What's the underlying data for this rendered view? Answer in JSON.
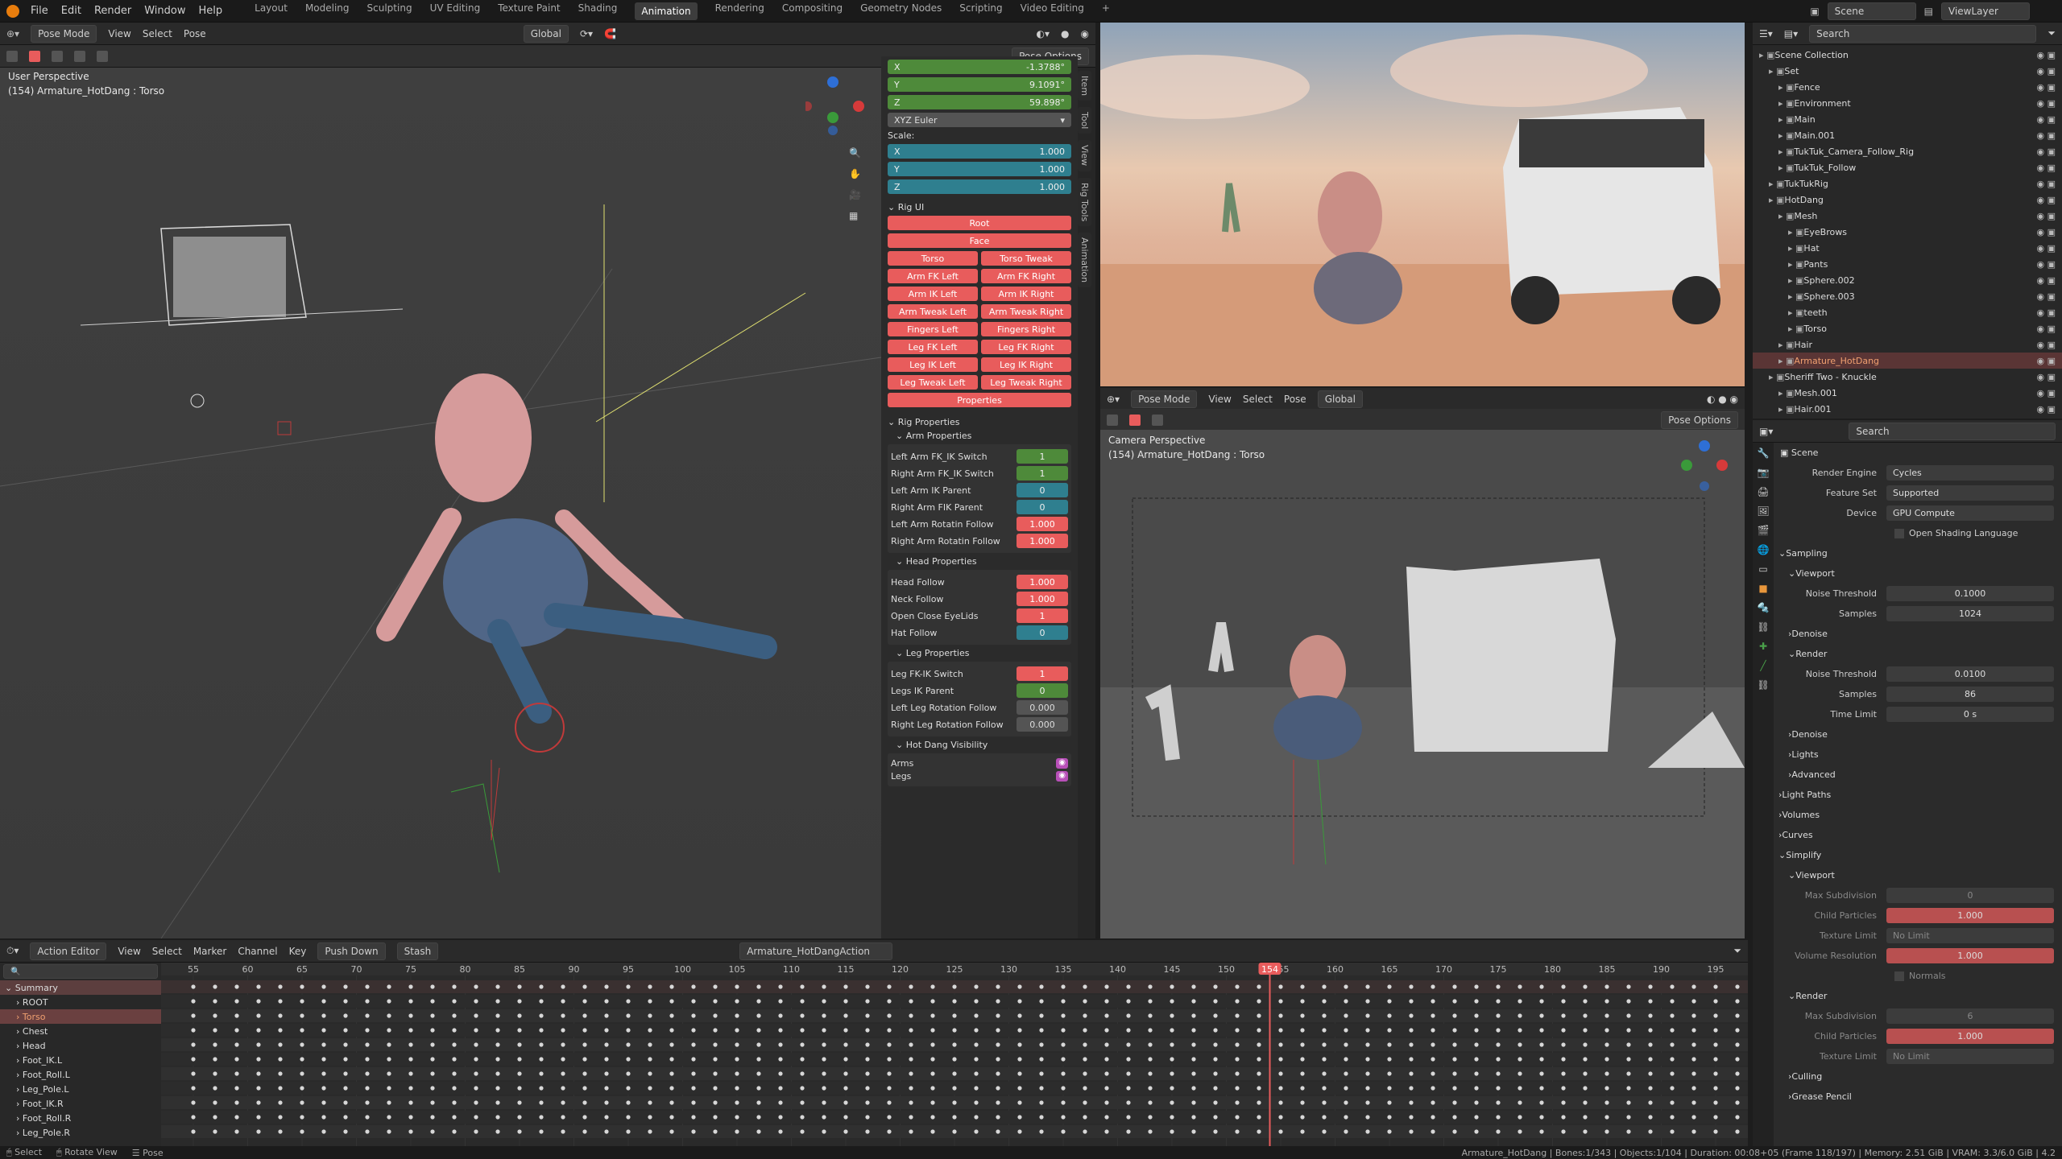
{
  "topbar": {
    "menus": [
      "File",
      "Edit",
      "Render",
      "Window",
      "Help"
    ],
    "workspaces": [
      "Layout",
      "Modeling",
      "Sculpting",
      "UV Editing",
      "Texture Paint",
      "Shading",
      "Animation",
      "Rendering",
      "Compositing",
      "Geometry Nodes",
      "Scripting",
      "Video Editing"
    ],
    "active_workspace": "Animation",
    "scene": "Scene",
    "view_layer": "ViewLayer"
  },
  "left_viewport": {
    "mode": "Pose Mode",
    "menus": [
      "View",
      "Select",
      "Pose"
    ],
    "orientation": "Global",
    "pose_options": "Pose Options",
    "info_line1": "User Perspective",
    "info_line2": "(154) Armature_HotDang : Torso",
    "side_tabs": [
      "Item",
      "Tool",
      "View",
      "Rig Tools",
      "Animation"
    ]
  },
  "npanel": {
    "rot": {
      "x": "-1.3788°",
      "y": "9.1091°",
      "z": "59.898°"
    },
    "rot_mode": "XYZ Euler",
    "scale_label": "Scale:",
    "scale": {
      "x": "1.000",
      "y": "1.000",
      "z": "1.000"
    },
    "rig_ui": "Rig UI",
    "buttons": {
      "root": "Root",
      "face": "Face",
      "torso": "Torso",
      "torso_tweak": "Torso Tweak",
      "arm_fk_left": "Arm FK Left",
      "arm_fk_right": "Arm FK Right",
      "arm_ik_left": "Arm IK Left",
      "arm_ik_right": "Arm IK Right",
      "arm_tweak_left": "Arm Tweak Left",
      "arm_tweak_right": "Arm Tweak Right",
      "fingers_left": "Fingers Left",
      "fingers_right": "Fingers Right",
      "leg_fk_left": "Leg FK Left",
      "leg_fk_right": "Leg FK Right",
      "leg_ik_left": "Leg IK Left",
      "leg_ik_right": "Leg IK Right",
      "leg_tweak_left": "Leg Tweak Left",
      "leg_tweak_right": "Leg Tweak Right",
      "properties": "Properties"
    },
    "rig_properties": "Rig Properties",
    "arm_properties": "Arm Properties",
    "arm_rows": [
      {
        "label": "Left Arm FK_IK Switch",
        "value": "1",
        "kind": "green"
      },
      {
        "label": "Right Arm FK_IK Switch",
        "value": "1",
        "kind": "green"
      },
      {
        "label": "Left Arm IK Parent",
        "value": "0",
        "kind": "teal"
      },
      {
        "label": "Right Arm FIK Parent",
        "value": "0",
        "kind": "teal"
      },
      {
        "label": "Left Arm Rotatin Follow",
        "value": "1.000",
        "kind": "red"
      },
      {
        "label": "Right Arm Rotatin Follow",
        "value": "1.000",
        "kind": "red"
      }
    ],
    "head_properties": "Head Properties",
    "head_rows": [
      {
        "label": "Head Follow",
        "value": "1.000",
        "kind": "red"
      },
      {
        "label": "Neck Follow",
        "value": "1.000",
        "kind": "red"
      },
      {
        "label": "Open Close EyeLids",
        "value": "1",
        "kind": "red"
      },
      {
        "label": "Hat Follow",
        "value": "0",
        "kind": "teal"
      }
    ],
    "leg_properties": "Leg Properties",
    "leg_rows": [
      {
        "label": "Leg FK-IK Switch",
        "value": "1",
        "kind": "red"
      },
      {
        "label": "Legs IK Parent",
        "value": "0",
        "kind": "green"
      },
      {
        "label": "Left Leg Rotation Follow",
        "value": "0.000",
        "kind": "gray"
      },
      {
        "label": "Right Leg Rotation Follow",
        "value": "0.000",
        "kind": "gray"
      }
    ],
    "visibility": "Hot Dang Visibility",
    "vis_rows": [
      "Arms",
      "Legs"
    ]
  },
  "camera_viewport": {
    "mode": "Pose Mode",
    "menus": [
      "View",
      "Select",
      "Pose"
    ],
    "orientation": "Global",
    "pose_options": "Pose Options",
    "info_line1": "Camera Perspective",
    "info_line2": "(154) Armature_HotDang : Torso"
  },
  "outliner": {
    "search": "Search",
    "items": [
      {
        "name": "Scene Collection",
        "depth": 0
      },
      {
        "name": "Set",
        "depth": 1
      },
      {
        "name": "Fence",
        "depth": 2
      },
      {
        "name": "Environment",
        "depth": 2
      },
      {
        "name": "Main",
        "depth": 2
      },
      {
        "name": "Main.001",
        "depth": 2
      },
      {
        "name": "TukTuk_Camera_Follow_Rig",
        "depth": 2
      },
      {
        "name": "TukTuk_Follow",
        "depth": 2
      },
      {
        "name": "TukTukRig",
        "depth": 1
      },
      {
        "name": "HotDang",
        "depth": 1
      },
      {
        "name": "Mesh",
        "depth": 2
      },
      {
        "name": "EyeBrows",
        "depth": 3
      },
      {
        "name": "Hat",
        "depth": 3
      },
      {
        "name": "Pants",
        "depth": 3
      },
      {
        "name": "Sphere.002",
        "depth": 3
      },
      {
        "name": "Sphere.003",
        "depth": 3
      },
      {
        "name": "teeth",
        "depth": 3
      },
      {
        "name": "Torso",
        "depth": 3
      },
      {
        "name": "Hair",
        "depth": 2
      },
      {
        "name": "Armature_HotDang",
        "depth": 2
      },
      {
        "name": "Sheriff Two - Knuckle",
        "depth": 1
      },
      {
        "name": "Mesh.001",
        "depth": 2
      },
      {
        "name": "Hair.001",
        "depth": 2
      }
    ]
  },
  "properties": {
    "search": "Search",
    "context": "Scene",
    "render_engine_label": "Render Engine",
    "render_engine": "Cycles",
    "feature_set_label": "Feature Set",
    "feature_set": "Supported",
    "device_label": "Device",
    "device": "GPU Compute",
    "osl": "Open Shading Language",
    "sampling": "Sampling",
    "viewport": "Viewport",
    "noise_threshold": "Noise Threshold",
    "vp_noise": "0.1000",
    "samples": "Samples",
    "vp_samples": "1024",
    "denoise": "Denoise",
    "render": "Render",
    "r_noise": "0.0100",
    "r_samples": "86",
    "time_limit": "Time Limit",
    "r_time": "0 s",
    "lights": "Lights",
    "advanced": "Advanced",
    "light_paths": "Light Paths",
    "volumes": "Volumes",
    "curves": "Curves",
    "simplify": "Simplify",
    "max_subdivision": "Max Subdivision",
    "s_vp_maxsub": "0",
    "child_particles": "Child Particles",
    "s_vp_child": "1.000",
    "texture_limit": "Texture Limit",
    "no_limit": "No Limit",
    "volume_resolution": "Volume Resolution",
    "s_vol": "1.000",
    "normals": "Normals",
    "s_r_maxsub": "6",
    "s_r_child": "1.000",
    "culling": "Culling",
    "grease_pencil": "Grease Pencil"
  },
  "action_editor": {
    "mode": "Action Editor",
    "menus": [
      "View",
      "Select",
      "Marker",
      "Channel",
      "Key"
    ],
    "push_down": "Push Down",
    "stash": "Stash",
    "action": "Armature_HotDangAction",
    "current_frame": "154",
    "ticks": [
      "55",
      "60",
      "65",
      "70",
      "75",
      "80",
      "85",
      "90",
      "95",
      "100",
      "105",
      "110",
      "115",
      "120",
      "125",
      "130",
      "135",
      "140",
      "145",
      "150",
      "155",
      "160",
      "165",
      "170",
      "175",
      "180",
      "185",
      "190",
      "195"
    ],
    "channels": [
      "Summary",
      "ROOT",
      "Torso",
      "Chest",
      "Head",
      "Foot_IK.L",
      "Foot_Roll.L",
      "Leg_Pole.L",
      "Foot_IK.R",
      "Foot_Roll.R",
      "Leg_Pole.R"
    ]
  },
  "statusbar": {
    "select": "Select",
    "rotate": "Rotate View",
    "pose": "Pose",
    "info": "Armature_HotDang | Bones:1/343 | Objects:1/104 | Duration: 00:08+05 (Frame 118/197) | Memory: 2.51 GiB | VRAM: 3.3/6.0 GiB | 4.2"
  },
  "colors": {
    "accent": "#e85c5c",
    "green": "#4e8a3a",
    "teal": "#2f7f8f",
    "active_tab": "#3d3d3d"
  }
}
